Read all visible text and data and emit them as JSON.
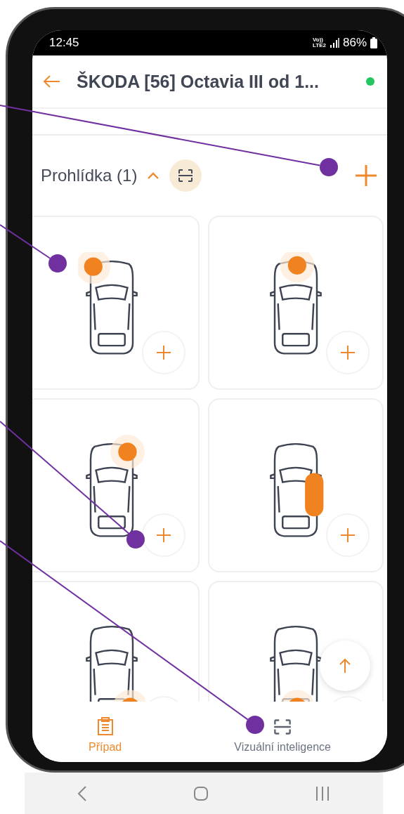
{
  "status_bar": {
    "time": "12:45",
    "volte": "Vo))",
    "network": "LTE2",
    "battery": "86%"
  },
  "header": {
    "title": "ŠKODA [56] Octavia III od 1...",
    "online": true
  },
  "section": {
    "title": "Prohlídka (1)",
    "expanded": true
  },
  "tiles": [
    {
      "kind": "front-left"
    },
    {
      "kind": "front"
    },
    {
      "kind": "front-right"
    },
    {
      "kind": "right-side"
    },
    {
      "kind": "rear-right"
    },
    {
      "kind": "rear"
    }
  ],
  "bottom_nav": [
    {
      "label": "Případ",
      "selected": true,
      "kind": "clipboard"
    },
    {
      "label": "Vizuální inteligence",
      "selected": false,
      "kind": "scan"
    }
  ]
}
